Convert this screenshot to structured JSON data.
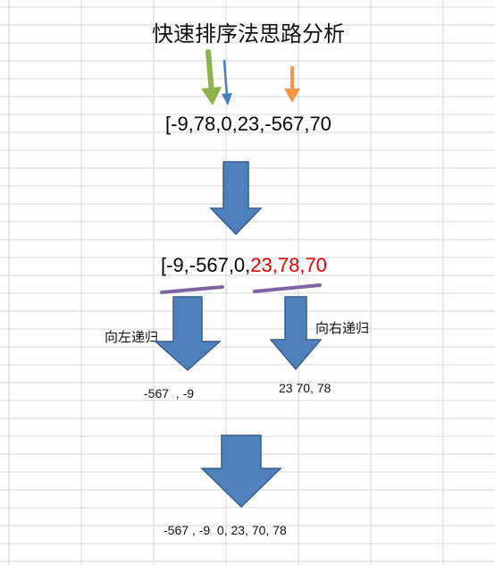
{
  "title": "快速排序法思路分析",
  "array_initial": "[-9,78,0,23,-567,70",
  "array_partitioned": {
    "left_part": "[-9,-567,0,",
    "right_part": "23,78,70"
  },
  "recurse_left_label": "向左递归",
  "recurse_right_label": "向右递归",
  "result_left": "-567  , -9",
  "result_right": "23 70, 78",
  "result_final": "-567 , -9  0, 23, 70, 78",
  "colors": {
    "arrow_fill": "#4f81bd",
    "arrow_stroke": "#385d8a",
    "pointer_green": "#8db24b",
    "pointer_blue": "#4a7ebb",
    "pointer_orange": "#f79646",
    "underline_purple": "#8064a2",
    "highlight_red": "#e00000",
    "grid_line": "#d4d4d4"
  }
}
